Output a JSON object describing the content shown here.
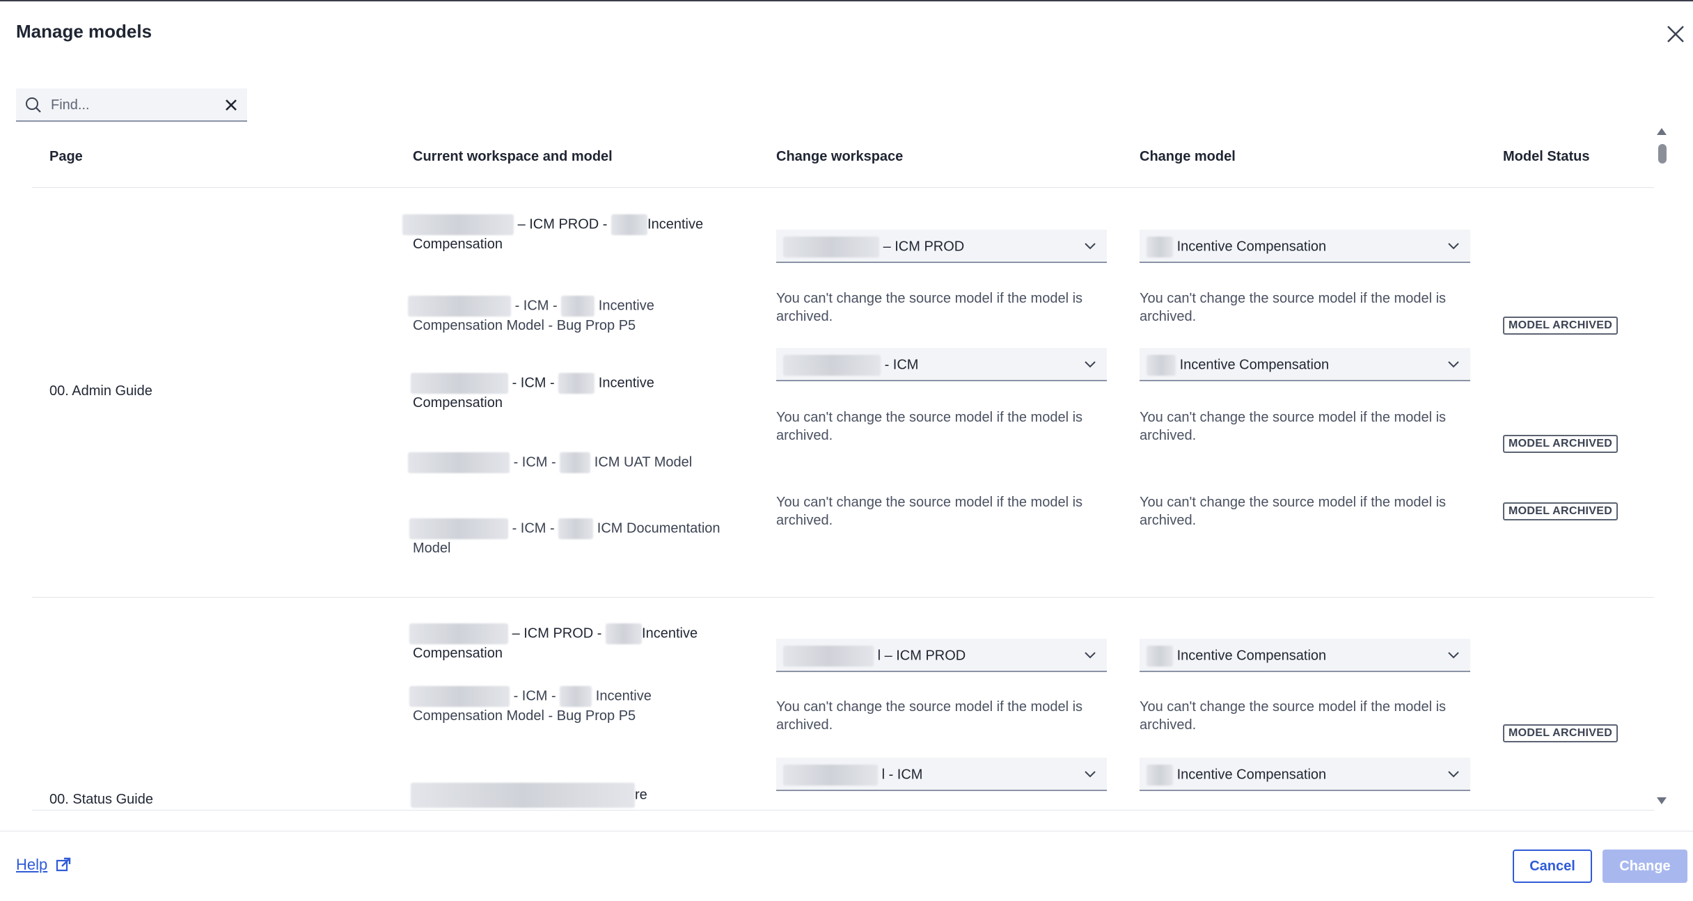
{
  "dialog": {
    "title": "Manage models",
    "search_placeholder": "Find..."
  },
  "columns": {
    "page": "Page",
    "current": "Current workspace and model",
    "change_workspace": "Change workspace",
    "change_model": "Change model",
    "status": "Model Status"
  },
  "notice": "You can't change the source model if the model is archived.",
  "status_badge": "MODEL ARCHIVED",
  "groups": [
    {
      "page": "00. Admin Guide",
      "rows": [
        {
          "current_a": "– ICM PROD -",
          "current_b": "Incentive",
          "current_c": "Compensation",
          "workspace": "– ICM PROD",
          "model": "Incentive Compensation",
          "status": ""
        },
        {
          "current_a": "- ICM -",
          "current_b": "Incentive",
          "current_c": "Compensation Model - Bug Prop P5",
          "workspace": "",
          "model": "",
          "status": "MODEL ARCHIVED"
        },
        {
          "current_a": "- ICM -",
          "current_b": "Incentive",
          "current_c": "Compensation",
          "workspace": "- ICM",
          "model": "Incentive Compensation",
          "status": ""
        },
        {
          "current_a": "- ICM -",
          "current_b": "ICM UAT Model",
          "current_c": "",
          "workspace": "",
          "model": "",
          "status": "MODEL ARCHIVED"
        },
        {
          "current_a": "- ICM -",
          "current_b": "ICM Documentation",
          "current_c": "Model",
          "workspace": "",
          "model": "",
          "status": "MODEL ARCHIVED"
        }
      ]
    },
    {
      "page": "00. Status Guide",
      "rows": [
        {
          "current_a": "– ICM PROD -",
          "current_b": "Incentive",
          "current_c": "Compensation",
          "workspace": "l – ICM PROD",
          "model": "Incentive Compensation",
          "status": ""
        },
        {
          "current_a": "- ICM -",
          "current_b": "Incentive",
          "current_c": "Compensation Model - Bug Prop P5",
          "workspace": "",
          "model": "",
          "status": "MODEL ARCHIVED"
        },
        {
          "current_a": "re",
          "current_b": "",
          "current_c": "",
          "workspace": "l - ICM",
          "model": "Incentive Compensation",
          "status": ""
        }
      ]
    }
  ],
  "footer": {
    "help": "Help",
    "cancel": "Cancel",
    "change": "Change"
  }
}
